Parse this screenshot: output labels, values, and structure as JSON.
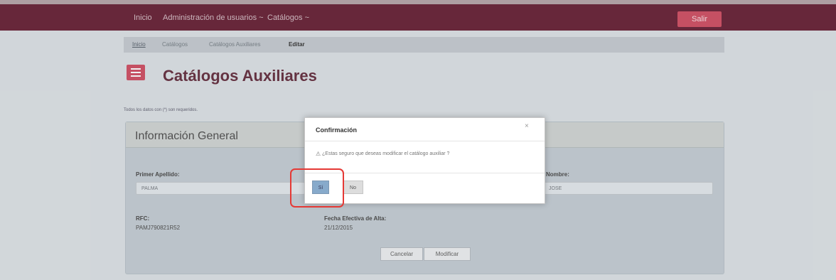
{
  "nav": {
    "home": "Inicio",
    "users": "Administración de usuarios ~",
    "catalogs": "Catálogos ~",
    "logout": "Salir"
  },
  "breadcrumb": [
    "Inicio",
    "Catálogos",
    "Catálogos Auxiliares",
    "Editar"
  ],
  "page": {
    "title": "Catálogos Auxiliares",
    "required_note": "Todos los datos con (*) son requeridos."
  },
  "panel": {
    "title": "Información General",
    "fields": {
      "primer_apellido_label": "Primer Apellido:",
      "primer_apellido_value": "PALMA",
      "nombre_label": "Nombre:",
      "nombre_value": "JOSE",
      "rfc_label": "RFC:",
      "rfc_value": "PAMJ790821R52",
      "fecha_label": "Fecha Efectiva de Alta:",
      "fecha_value": "21/12/2015"
    },
    "buttons": {
      "cancel": "Cancelar",
      "modify": "Modificar"
    }
  },
  "modal": {
    "title": "Confirmación",
    "close": "×",
    "question": "¿Estas seguro que deseas modificar el catálogo auxiliar ?",
    "yes": "Sí",
    "no": "No"
  },
  "colors": {
    "navbar": "#6e2a3e",
    "accent": "#d2556a",
    "title": "#6b3747",
    "highlight": "#e53935"
  },
  "icons": {
    "menu": "menu-icon",
    "warning": "warning-icon",
    "close": "close-icon"
  }
}
